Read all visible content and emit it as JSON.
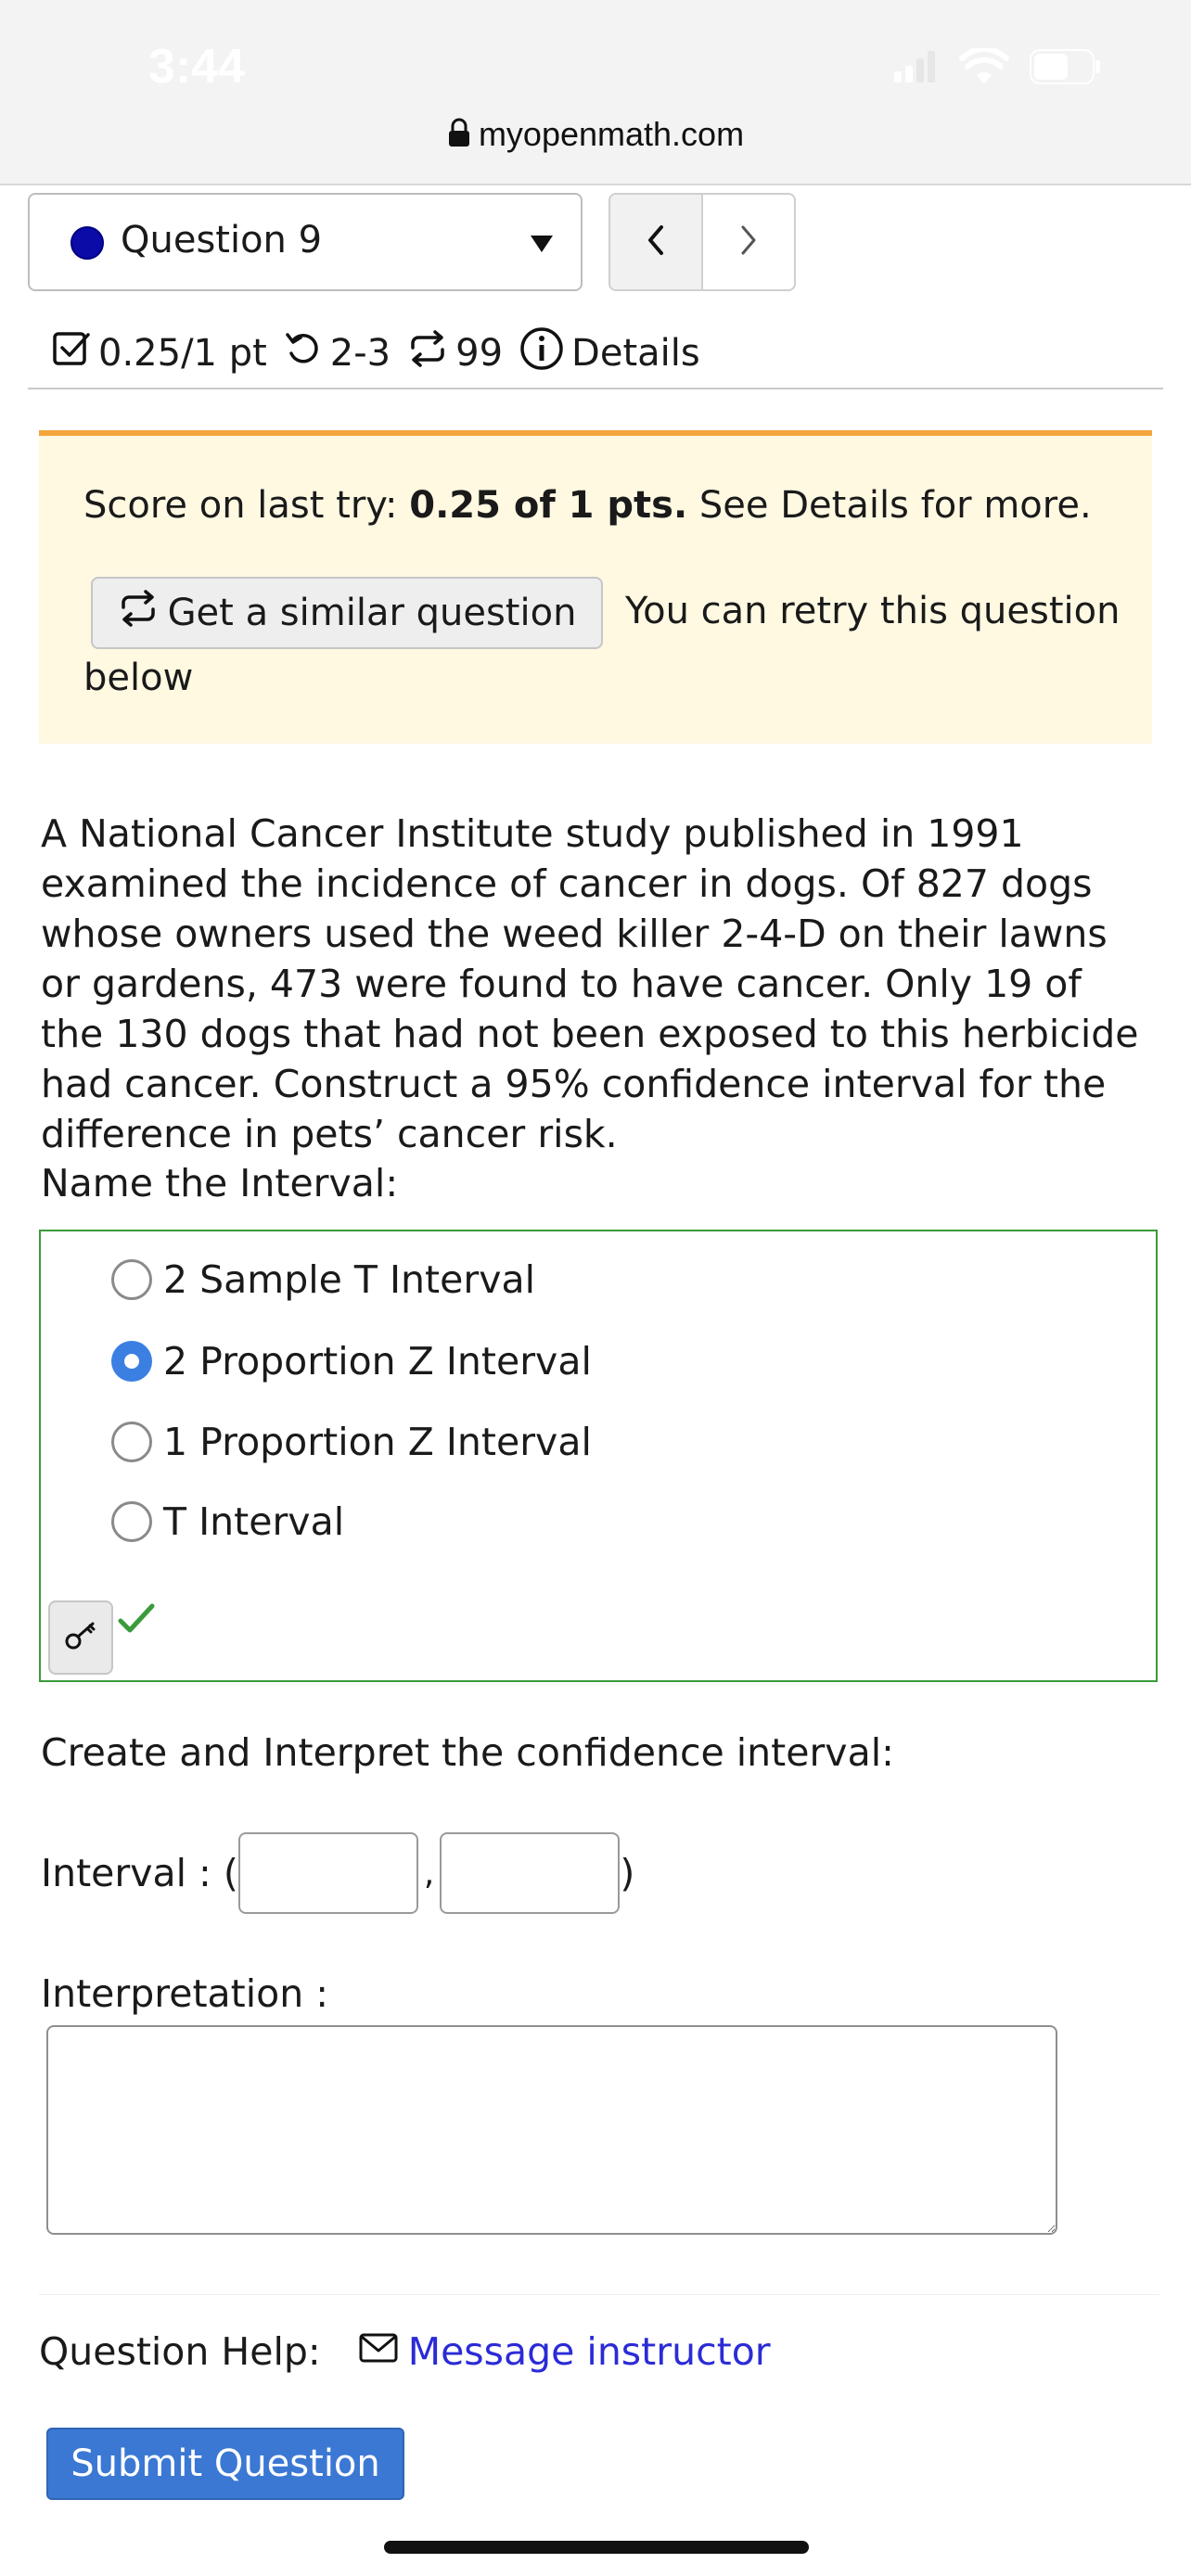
{
  "status_bar": {
    "time": "3:44",
    "url": "myopenmath.com"
  },
  "question_nav": {
    "selected": "Question 9",
    "prev_icon": "chevron-left-icon",
    "next_icon": "chevron-right-icon"
  },
  "meta": {
    "points": "0.25/1 pt",
    "attempts": "2-3",
    "retries": "99",
    "details": "Details"
  },
  "notice": {
    "score_prefix": "Score on last try: ",
    "score_value": "0.25 of 1 pts.",
    "score_suffix": " See Details for more.",
    "similar_button": "Get a similar question",
    "retry_text": "You can retry this question",
    "retry_text_2": "below"
  },
  "problem": {
    "text": "A National Cancer Institute study published in 1991 examined the incidence of cancer in dogs. Of 827 dogs whose owners used the weed killer 2-4-D on their lawns or gardens, 473 were found to have cancer. Only 19 of the 130 dogs that had not been exposed to this herbicide had cancer. Construct a 95% confidence interval for the difference in pets’ cancer risk."
  },
  "name_interval": {
    "label": "Name the Interval:",
    "options": [
      "2 Sample T Interval",
      "2 Proportion Z Interval",
      "1 Proportion Z Interval",
      "T Interval"
    ],
    "selected_index": 1
  },
  "create": {
    "label": "Create and Interpret the confidence interval:",
    "interval_label": "Interval : (",
    "comma": ",",
    "close_paren": ")",
    "interpretation_label": "Interpretation :",
    "lower_value": "",
    "upper_value": "",
    "interpretation_value": ""
  },
  "help": {
    "label": "Question Help:",
    "message_link": "Message instructor"
  },
  "submit": {
    "label": "Submit Question"
  },
  "colors": {
    "accent_blue": "#3b78d4",
    "correct_green": "#3b9a3b",
    "notice_bg": "#fff9e2",
    "notice_border": "#f4a53c",
    "link_blue": "#2b2bd6"
  }
}
